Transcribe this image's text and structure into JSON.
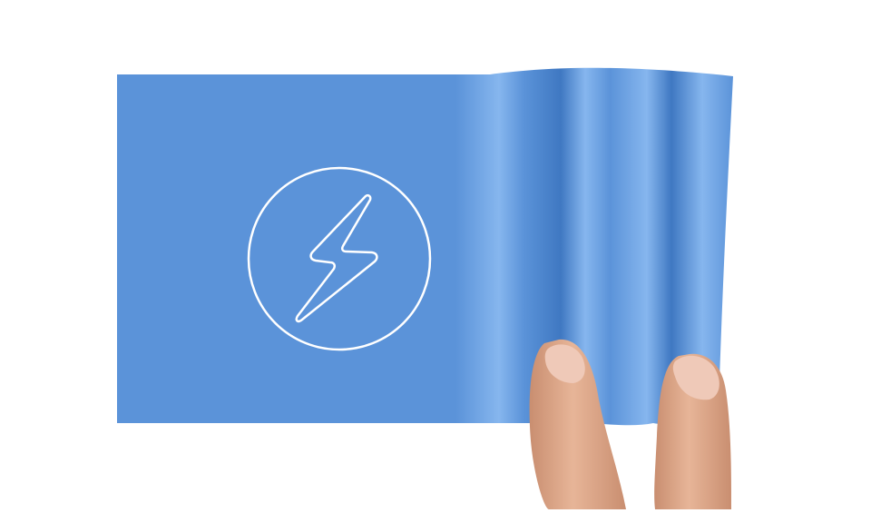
{
  "scene": {
    "background_color": "#ffffff",
    "sheet_color": "#5b93d9",
    "sheet_highlight_color": "#86b6ee",
    "sheet_shadow_color": "#3f78c2",
    "emblem_color": "#ffffff",
    "emblem_icon": "lightning-bolt-icon",
    "skin_color": "#e7b598",
    "skin_shadow_color": "#c98e70",
    "nail_color": "#efc9b8"
  }
}
